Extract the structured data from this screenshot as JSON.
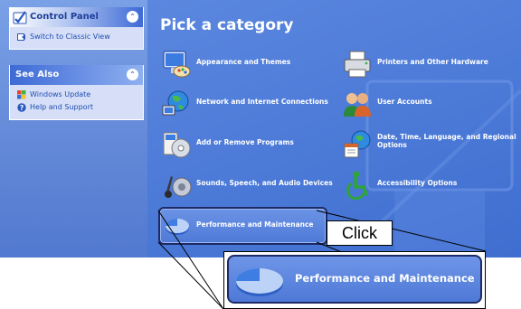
{
  "sidebar": {
    "control_panel": {
      "title": "Control Panel",
      "links": [
        {
          "label": "Switch to Classic View",
          "icon": "classic-view-icon"
        }
      ]
    },
    "see_also": {
      "title": "See Also",
      "links": [
        {
          "label": "Windows Update",
          "icon": "windows-update-icon"
        },
        {
          "label": "Help and Support",
          "icon": "help-icon"
        }
      ]
    }
  },
  "main": {
    "title": "Pick a category",
    "categories": [
      {
        "label": "Appearance and Themes",
        "icon": "appearance-themes-icon"
      },
      {
        "label": "Printers and Other Hardware",
        "icon": "printer-icon"
      },
      {
        "label": "Network and Internet Connections",
        "icon": "network-globe-icon"
      },
      {
        "label": "User Accounts",
        "icon": "user-accounts-icon"
      },
      {
        "label": "Add or Remove Programs",
        "icon": "add-remove-programs-icon"
      },
      {
        "label": "Date, Time, Language, and Regional Options",
        "icon": "date-time-icon"
      },
      {
        "label": "Sounds, Speech, and Audio Devices",
        "icon": "sound-icon"
      },
      {
        "label": "Accessibility Options",
        "icon": "accessibility-icon"
      },
      {
        "label": "Performance and Maintenance",
        "icon": "performance-pie-icon"
      }
    ]
  },
  "callout": {
    "action": "Click",
    "zoom_label": "Performance and Maintenance"
  },
  "colors": {
    "sidebar_bg": "#6389d8",
    "main_bg": "#4a78d6",
    "highlight_border": "#1c2a66",
    "link_text": "#1f4db3"
  }
}
